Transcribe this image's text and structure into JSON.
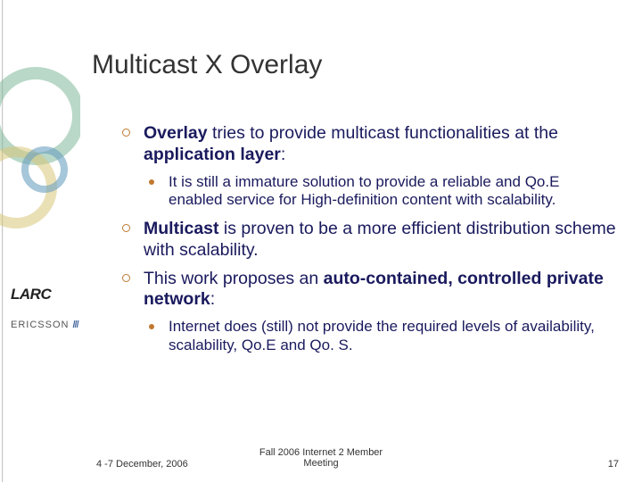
{
  "title": "Multicast X Overlay",
  "body": {
    "i1": {
      "pre": "Overlay",
      "post": " tries to provide multicast functionalities at the ",
      "end": "application layer",
      "colon": ":"
    },
    "s1": "It is still a immature solution to provide a reliable and Qo.E enabled service for High-definition content with scalability.",
    "i2": {
      "pre": "Multicast",
      "post": " is proven to be a more efficient distribution scheme with scalability."
    },
    "i3": {
      "pre": "This work proposes an ",
      "b": "auto-contained, controlled private network",
      "colon": ":"
    },
    "s2": "Internet does (still) not provide the required levels of availability, scalability, Qo.E and Qo. S."
  },
  "footer": {
    "left": "4 -7 December, 2006",
    "center1": "Fall 2006 Internet 2 Member",
    "center2": "Meeting",
    "right": "17"
  },
  "logos": {
    "larc": "LARC",
    "ericsson": "ERICSSON"
  }
}
